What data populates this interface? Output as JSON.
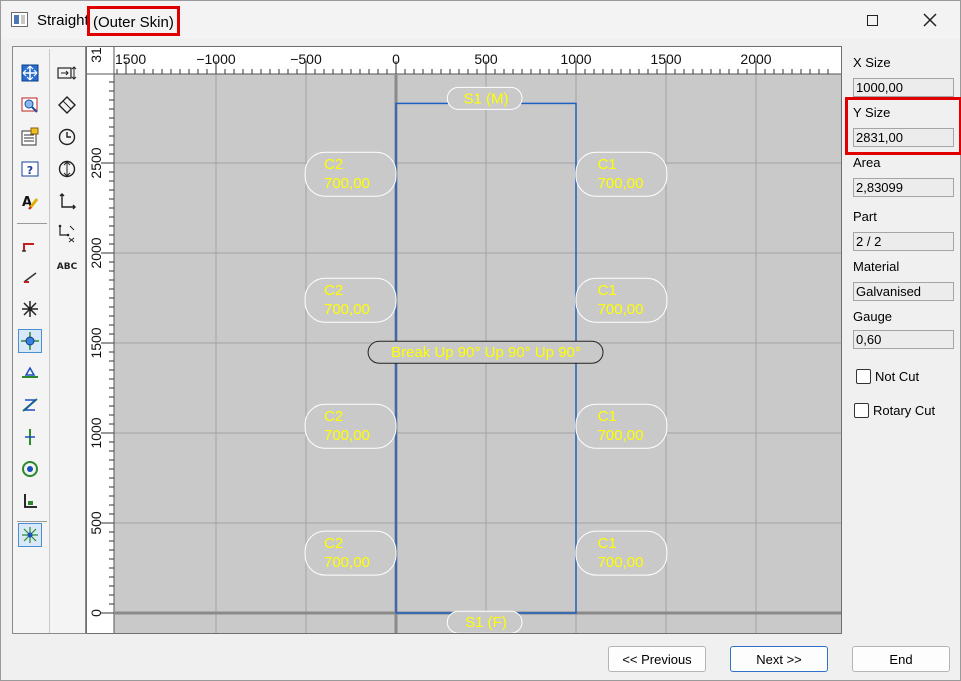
{
  "window": {
    "title": "Straight",
    "title_highlight": "(Outer Skin)"
  },
  "axes": {
    "x_ticks": [
      "1500",
      "−1000",
      "−500",
      "0",
      "500",
      "1000",
      "1500",
      "2000"
    ],
    "y_ticks": [
      "0",
      "500",
      "1000",
      "1500",
      "2000",
      "2500",
      "31"
    ]
  },
  "shape": {
    "top_label": "S1 (M)",
    "bottom_label": "S1 (F)",
    "break_label": "Break Up 90° Up 90° Up 90°",
    "left_tag": "C2",
    "left_value": "700,00",
    "right_tag": "C1",
    "right_value": "700,00",
    "text_color": "#ffff00",
    "outline_color": "#1f5fbf"
  },
  "toolbar": {
    "abc": "ABC"
  },
  "properties": {
    "x_size_label": "X Size",
    "x_size_value": "1000,00",
    "y_size_label": "Y Size",
    "y_size_value": "2831,00",
    "area_label": "Area",
    "area_value": "2,83099",
    "part_label": "Part",
    "part_value": "2 / 2",
    "material_label": "Material",
    "material_value": "Galvanised",
    "gauge_label": "Gauge",
    "gauge_value": "0,60",
    "not_cut_label": "Not Cut",
    "not_cut_checked": false,
    "rotary_cut_label": "Rotary Cut",
    "rotary_cut_checked": false
  },
  "buttons": {
    "previous": "<< Previous",
    "next": "Next >>",
    "end": "End"
  },
  "colors": {
    "highlight": "#e00000",
    "canvas_bg": "#c9c9c9",
    "accent": "#2f73c9"
  }
}
